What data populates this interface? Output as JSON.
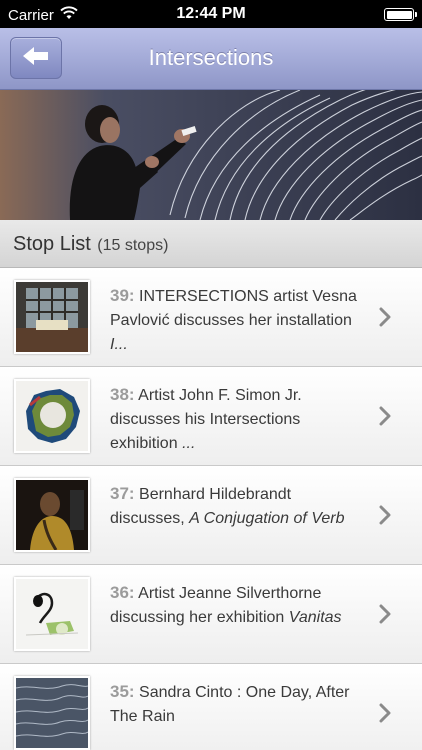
{
  "status_bar": {
    "carrier": "Carrier",
    "time": "12:44 PM"
  },
  "nav": {
    "title": "Intersections",
    "back_icon": "back-arrow-icon"
  },
  "list_header": {
    "title": "Stop List",
    "count": "(15 stops)"
  },
  "stops": [
    {
      "number": "39:",
      "text": "INTERSECTIONS artist Vesna Pavlović discusses her installation",
      "italic": "I..."
    },
    {
      "number": "38:",
      "text": "Artist John F. Simon Jr. discusses his Intersections exhibition",
      "italic": "..."
    },
    {
      "number": "37:",
      "text": "Bernhard Hildebrandt discusses,",
      "italic": "A Conjugation of Verb"
    },
    {
      "number": "36:",
      "text": "Artist Jeanne Silverthorne discussing her exhibition",
      "italic": "Vanitas"
    },
    {
      "number": "35:",
      "text": "Sandra Cinto : One Day, After The Rain",
      "italic": ""
    }
  ],
  "colors": {
    "nav_top": "#b9bfe7",
    "nav_bottom": "#8e96c7",
    "number_gray": "#9b9b9b"
  }
}
